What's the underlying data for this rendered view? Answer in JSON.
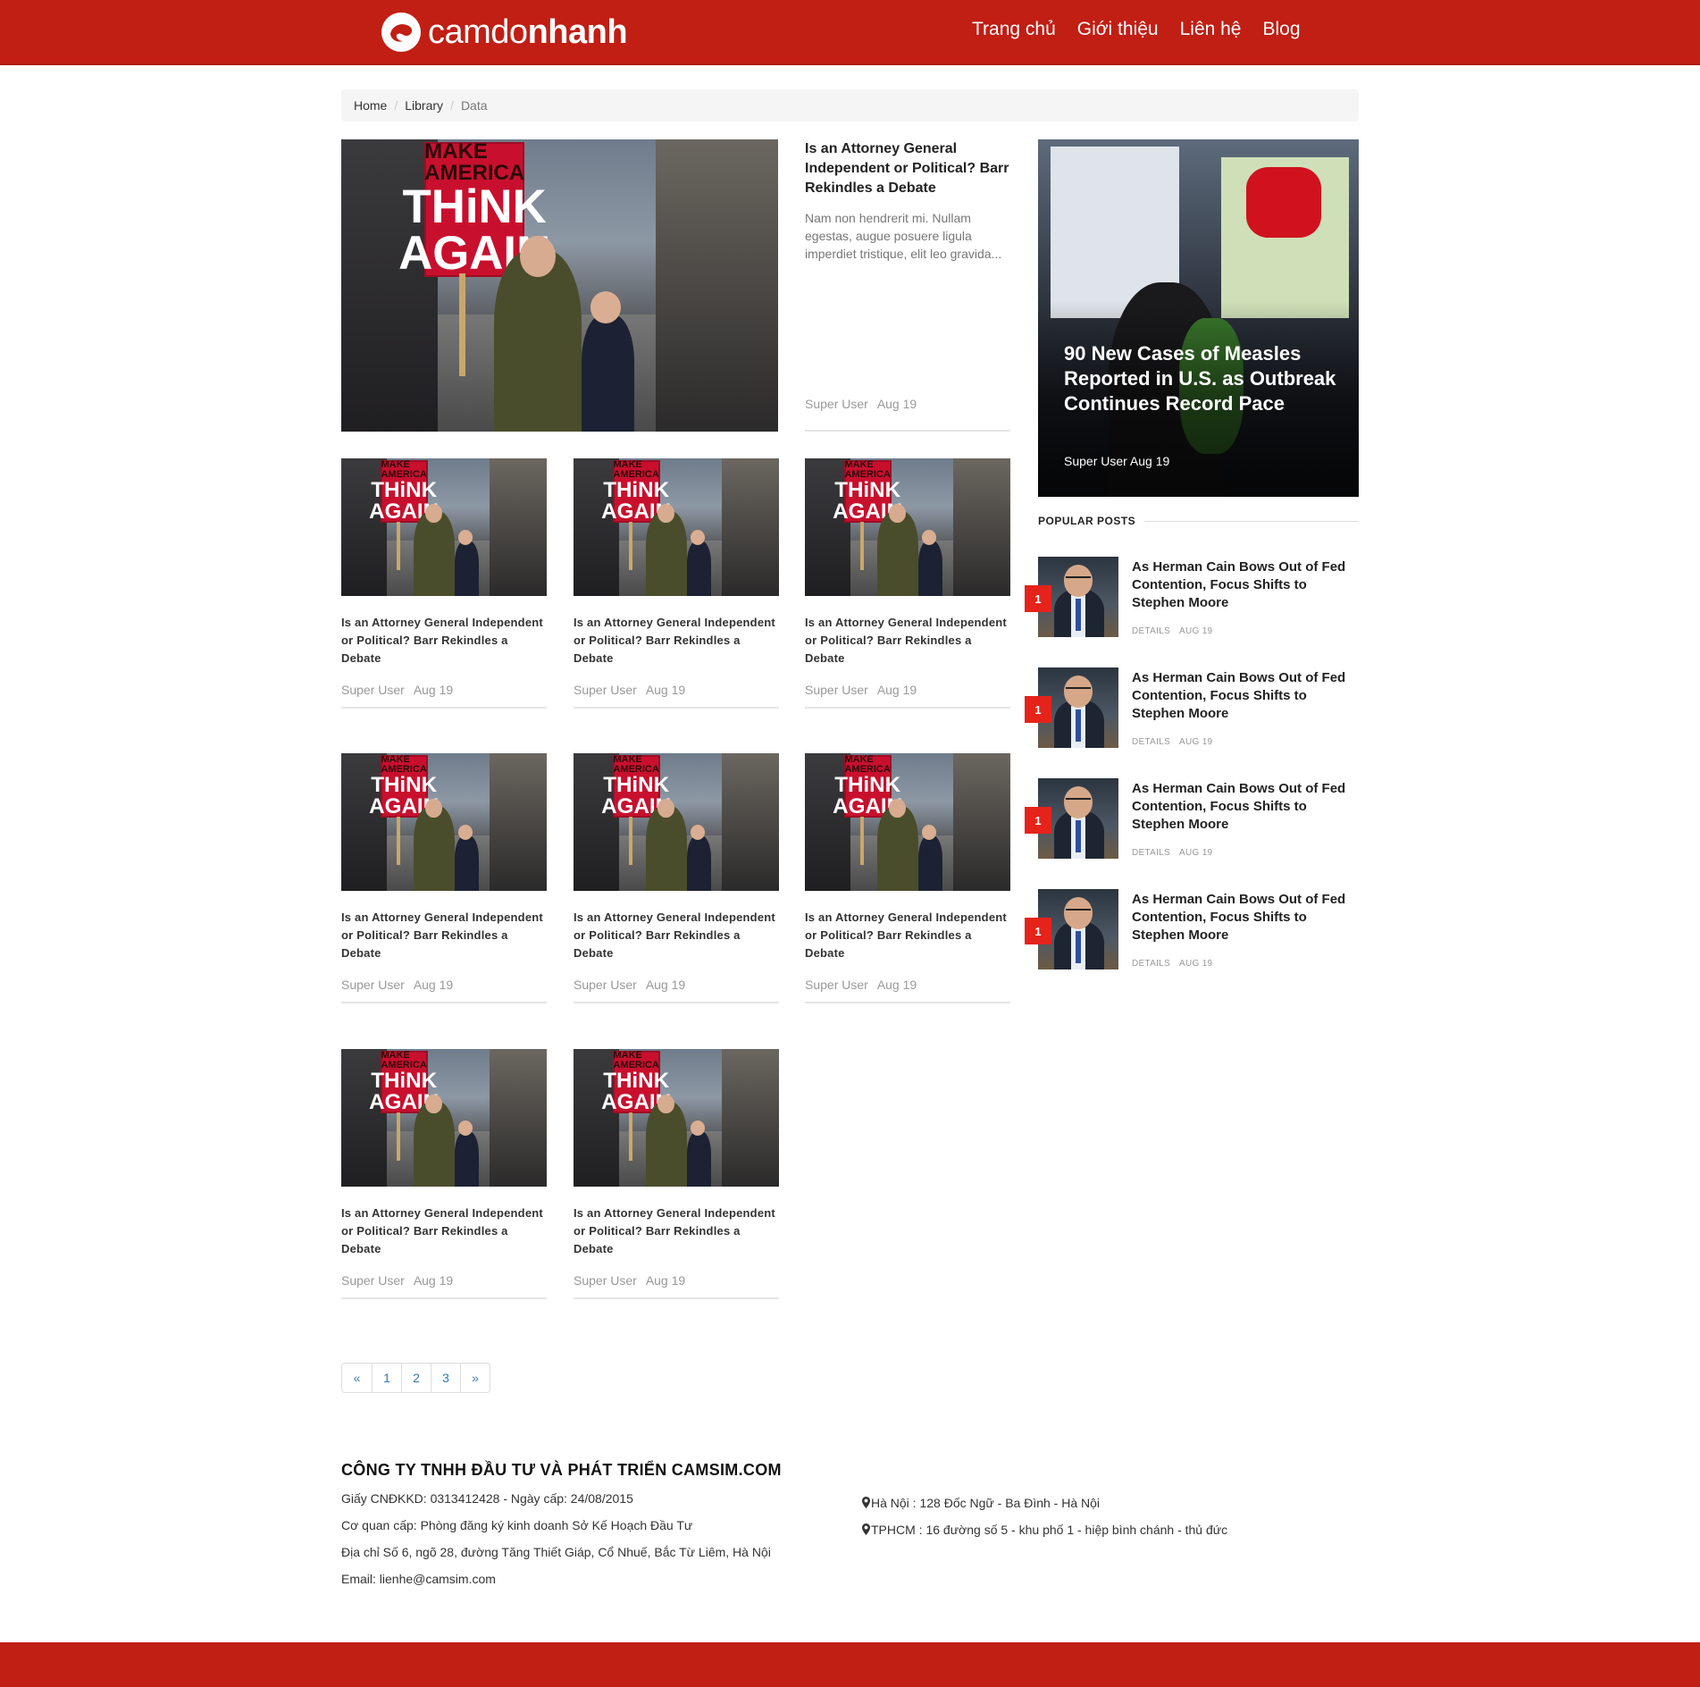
{
  "brand": {
    "name_light": "camdo",
    "name_bold": "nhanh",
    "color": "#c11e14"
  },
  "nav": [
    "Trang chủ",
    "Giới thiệu",
    "Liên hệ",
    "Blog"
  ],
  "breadcrumb": [
    "Home",
    "Library",
    "Data"
  ],
  "featured": {
    "title": "Is an Attorney General Independent or Political? Barr Rekindles a Debate",
    "excerpt": "Nam non hendrerit mi. Nullam egestas, augue posuere ligula imperdiet tristique, elit leo gravida...",
    "author": "Super User",
    "date": "Aug 19"
  },
  "cards": [
    {
      "title": "Is an Attorney General Independent or Political? Barr Rekindles a Debate",
      "author": "Super User",
      "date": "Aug 19"
    },
    {
      "title": "Is an Attorney General Independent or Political? Barr Rekindles a Debate",
      "author": "Super User",
      "date": "Aug 19"
    },
    {
      "title": "Is an Attorney General Independent or Political? Barr Rekindles a Debate",
      "author": "Super User",
      "date": "Aug 19"
    },
    {
      "title": "Is an Attorney General Independent or Political? Barr Rekindles a Debate",
      "author": "Super User",
      "date": "Aug 19"
    },
    {
      "title": "Is an Attorney General Independent or Political? Barr Rekindles a Debate",
      "author": "Super User",
      "date": "Aug 19"
    },
    {
      "title": "Is an Attorney General Independent or Political? Barr Rekindles a Debate",
      "author": "Super User",
      "date": "Aug 19"
    },
    {
      "title": "Is an Attorney General Independent or Political? Barr Rekindles a Debate",
      "author": "Super User",
      "date": "Aug 19"
    },
    {
      "title": "Is an Attorney General Independent or Political? Barr Rekindles a Debate",
      "author": "Super User",
      "date": "Aug 19"
    }
  ],
  "photo_sign": {
    "line1": "MAKE AMERICA",
    "line2": "THiNK",
    "line3": "AGAIN"
  },
  "side_featured": {
    "title": "90 New Cases of Measles Reported in U.S. as Outbreak Continues Record Pace",
    "meta": "Super User Aug 19"
  },
  "popular": {
    "heading": "POPULAR POSTS",
    "items": [
      {
        "rank": "1",
        "title": "As Herman Cain Bows Out of Fed Contention, Focus Shifts to Stephen Moore",
        "details": "DETAILS",
        "date": "AUG 19"
      },
      {
        "rank": "1",
        "title": "As Herman Cain Bows Out of Fed Contention, Focus Shifts to Stephen Moore",
        "details": "DETAILS",
        "date": "AUG 19"
      },
      {
        "rank": "1",
        "title": "As Herman Cain Bows Out of Fed Contention, Focus Shifts to Stephen Moore",
        "details": "DETAILS",
        "date": "AUG 19"
      },
      {
        "rank": "1",
        "title": "As Herman Cain Bows Out of Fed Contention, Focus Shifts to Stephen Moore",
        "details": "DETAILS",
        "date": "AUG 19"
      }
    ]
  },
  "pagination": [
    "«",
    "1",
    "2",
    "3",
    "»"
  ],
  "footer": {
    "company": "CÔNG TY TNHH ĐẦU TƯ VÀ PHÁT TRIỂN CAMSIM.COM",
    "lines": [
      "Giấy CNĐKKD: 0313412428 - Ngày cấp: 24/08/2015",
      "Cơ quan cấp: Phòng đăng ký kinh doanh Sở Kế Hoạch Đầu Tư",
      "Địa chỉ Số 6, ngõ 28, đường Tăng Thiết Giáp, Cổ Nhuế, Bắc Từ Liêm, Hà Nội",
      "Email: lienhe@camsim.com"
    ],
    "addresses": [
      "Hà Nội : 128 Đốc Ngữ - Ba Đình - Hà Nội",
      "TPHCM : 16 đường số 5 - khu phố 1 - hiệp bình chánh - thủ đức"
    ]
  }
}
